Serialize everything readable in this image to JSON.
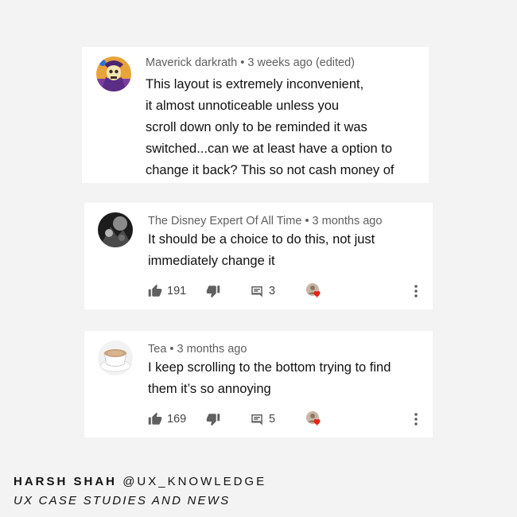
{
  "comments": [
    {
      "author": "Maverick darkrath",
      "time": "3 weeks ago (edited)",
      "lines": [
        "This layout is extremely inconvenient,",
        "it almost unnoticeable unless you",
        "scroll down only to be reminded it was",
        "switched...can we at least have a option to",
        "change it back? This so not cash money of"
      ],
      "avatar": "skeletor-avatar"
    },
    {
      "author": "The Disney Expert Of All Time",
      "time": "3 months ago",
      "lines": [
        "It should be a choice to do this, not just",
        "immediately change it"
      ],
      "likes": "191",
      "replies": "3",
      "avatar": "bw-photo-avatar"
    },
    {
      "author": "Tea",
      "time": "3 months ago",
      "lines": [
        "I keep scrolling to the bottom trying to find",
        "them it’s so annoying"
      ],
      "likes": "169",
      "replies": "5",
      "avatar": "teacup-avatar"
    }
  ],
  "separator": "•",
  "icons": {
    "like": "thumbs-up-icon",
    "dislike": "thumbs-down-icon",
    "reply": "comment-icon",
    "creator_heart": "creator-heart-icon",
    "more": "more-vert-icon"
  },
  "colors": {
    "heart": "#e62117",
    "icon": "#606060"
  },
  "footer": {
    "name": "HARSH SHAH",
    "handle": "@UX_KNOWLEDGE",
    "subtitle": "UX CASE STUDIES AND NEWS"
  }
}
